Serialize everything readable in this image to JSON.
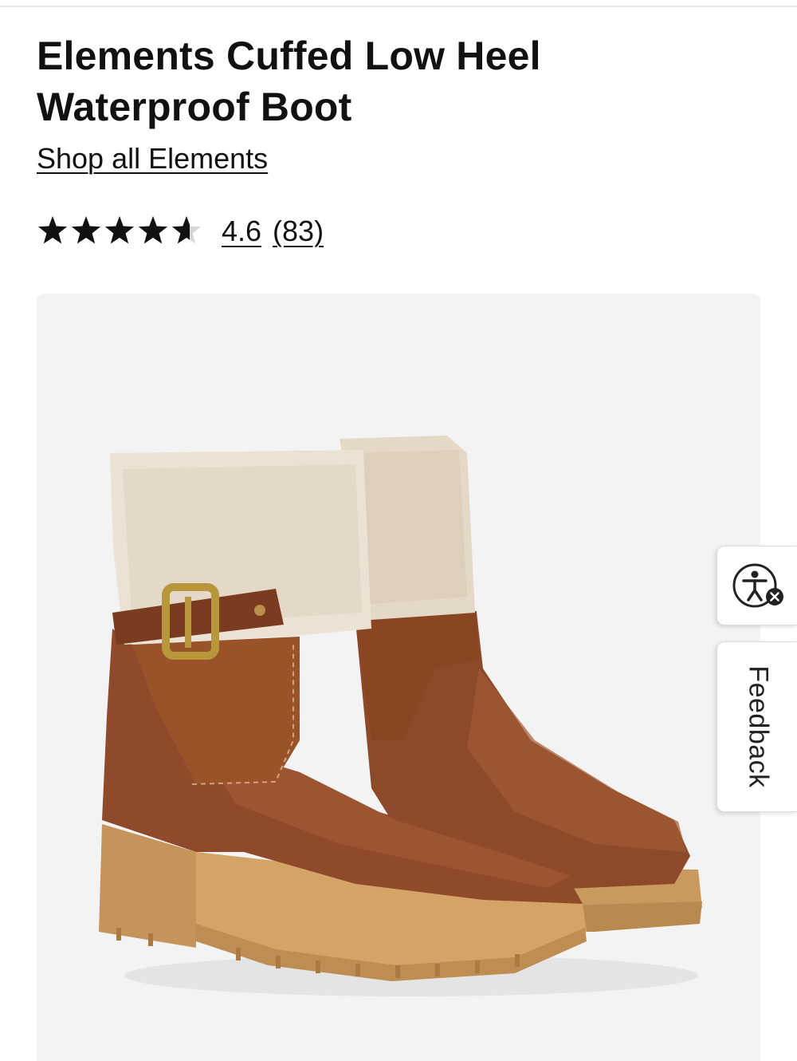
{
  "product": {
    "title": "Elements Cuffed Low Heel Waterproof Boot",
    "shop_all_link": "Shop all Elements",
    "rating": {
      "stars_out_of_5": 4.6,
      "value": "4.6",
      "reviews": "(83)"
    },
    "image": {
      "depicts": "pair of brown leather ankle boots with shearling cuff and buckle strap"
    }
  },
  "side_widgets": {
    "accessibility_icon": "accessibility-icon",
    "feedback_label": "Feedback"
  },
  "colors": {
    "text": "#111111",
    "panel_bg": "#f3f3f3",
    "star_fill": "#111111",
    "star_empty": "#d6d6d6"
  }
}
